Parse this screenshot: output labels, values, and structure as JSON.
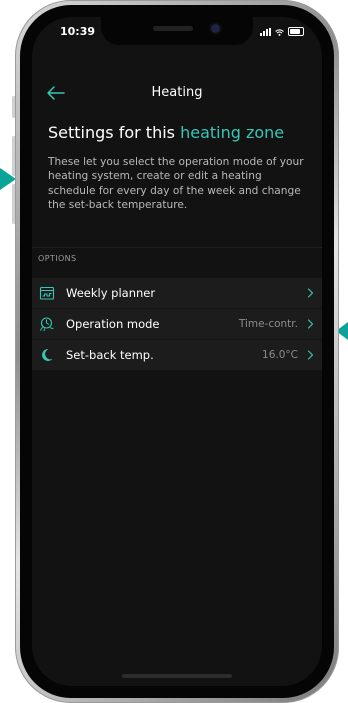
{
  "status_bar": {
    "time": "10:39"
  },
  "nav": {
    "title": "Heating"
  },
  "headline": {
    "prefix": "Settings for this ",
    "accent": "heating zone"
  },
  "description": "These let you select the operation mode of your heating system, create or edit a heating schedule for every day of the week and change the set-back temperature.",
  "section_label": "OPTIONS",
  "options": [
    {
      "label": "Weekly planner",
      "value": "",
      "icon": "calendar-icon"
    },
    {
      "label": "Operation mode",
      "value": "Time-contr.",
      "icon": "operation-mode-icon"
    },
    {
      "label": "Set-back temp.",
      "value": "16.0°C",
      "icon": "moon-icon"
    }
  ],
  "colors": {
    "accent": "#38c6b4",
    "background": "#121212",
    "row_background": "#1c1c1c",
    "decor_arrow": "#0aa39a"
  }
}
